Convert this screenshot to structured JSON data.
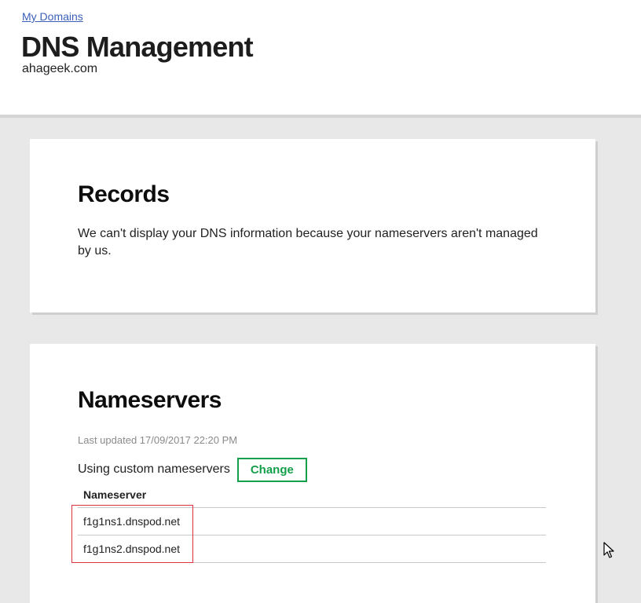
{
  "header": {
    "breadcrumb": "My Domains",
    "title": "DNS Management",
    "domain": "ahageek.com"
  },
  "records": {
    "heading": "Records",
    "message": "We can't display your DNS information because your nameservers aren't managed by us."
  },
  "nameservers": {
    "heading": "Nameservers",
    "last_updated": "Last updated 17/09/2017 22:20 PM",
    "mode_text": "Using custom nameservers",
    "change_label": "Change",
    "column_header": "Nameserver",
    "rows": [
      "f1g1ns1.dnspod.net",
      "f1g1ns2.dnspod.net"
    ]
  },
  "colors": {
    "accent_green": "#14a04a",
    "link_blue": "#3b5fb8",
    "highlight_red": "#e0303c"
  }
}
